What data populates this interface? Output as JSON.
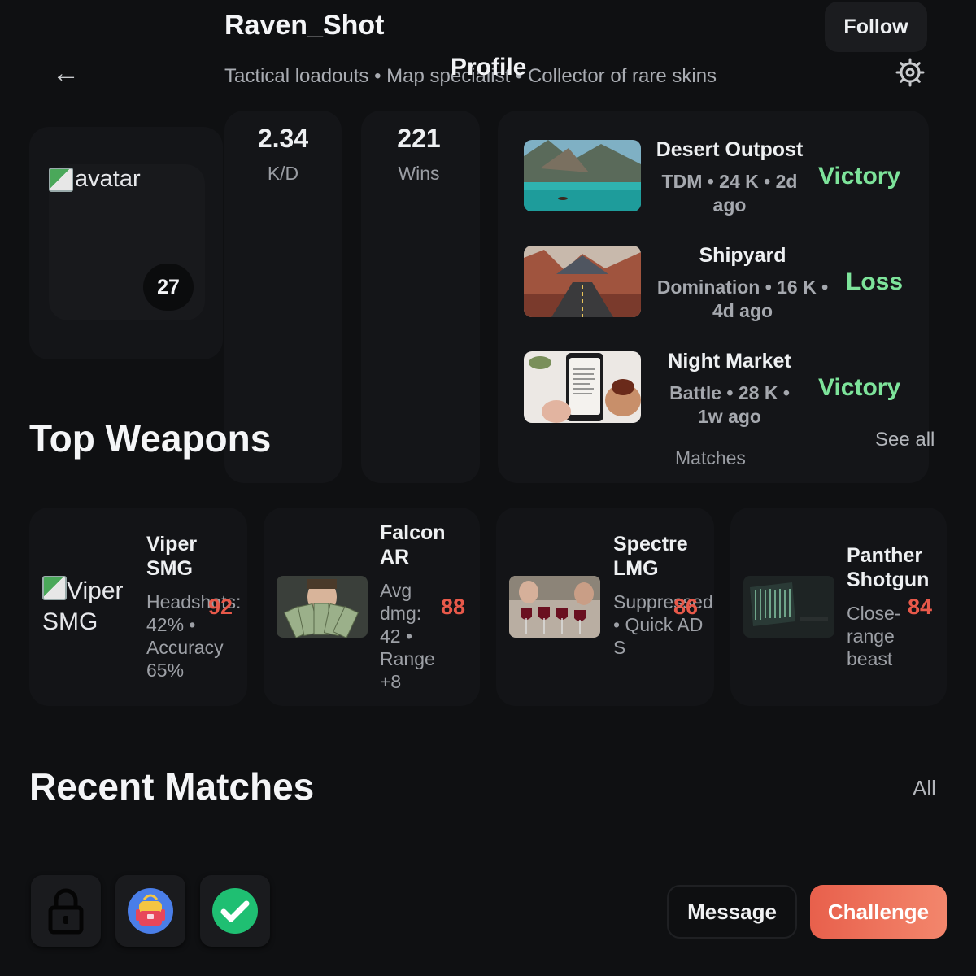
{
  "header": {
    "back_icon": "arrow-left-icon",
    "title": "Profile",
    "settings_icon": "gear-icon",
    "follow_label": "Follow"
  },
  "profile": {
    "username": "Raven_Shot",
    "bio": "Tactical loadouts • Map specialist • Collector of rare skins",
    "avatar_alt": "avatar",
    "level": "27"
  },
  "stats": [
    {
      "value": "2.34",
      "label": "K/D"
    },
    {
      "value": "221",
      "label": "Wins"
    }
  ],
  "matches_panel": {
    "caption": "Matches",
    "see_all": "See all",
    "items": [
      {
        "name": "Desert Outpost",
        "meta": "TDM • 24 K • 2d ago",
        "result": "Victory"
      },
      {
        "name": "Shipyard",
        "meta": "Domination • 16 K • 4d ago",
        "result": "Loss"
      },
      {
        "name": "Night Market",
        "meta": "Battle • 28 K • 1w ago",
        "result": "Victory"
      }
    ]
  },
  "top_weapons": {
    "title": "Top Weapons",
    "items": [
      {
        "name": "Viper SMG",
        "image_alt": "Viper SMG",
        "desc": "Headshots: 42% • Accuracy 65%",
        "score": "92"
      },
      {
        "name": "Falcon AR",
        "desc": "Avg dmg: 42 • Range +8",
        "score": "88"
      },
      {
        "name": "Spectre LMG",
        "desc": "Suppressed • Quick ADS",
        "score": "86"
      },
      {
        "name": "Panther Shotgun",
        "desc": "Close-range beast",
        "score": "84"
      }
    ]
  },
  "recent_matches": {
    "title": "Recent Matches",
    "all_label": "All"
  },
  "bottom_bar": {
    "icons": [
      "lock-icon",
      "backpack-icon",
      "check-circle-icon"
    ],
    "message_label": "Message",
    "challenge_label": "Challenge"
  },
  "colors": {
    "background": "#0f1012",
    "victory": "#7de39a",
    "weapon_score": "#e8594a",
    "challenge": "#f0705a"
  }
}
